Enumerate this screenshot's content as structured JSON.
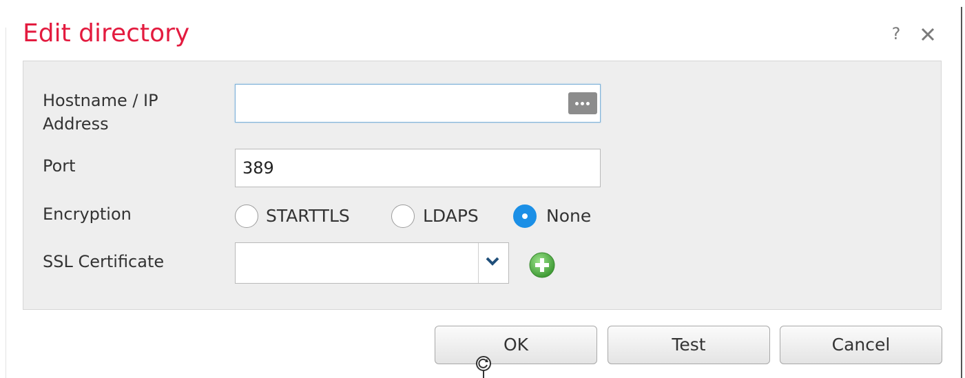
{
  "dialog": {
    "title": "Edit directory",
    "help_glyph": "?",
    "close_glyph": "✕"
  },
  "form": {
    "hostname": {
      "label": "Hostname / IP Address",
      "value": "",
      "button_icon": "ellipsis-icon"
    },
    "port": {
      "label": "Port",
      "value": "389"
    },
    "encryption": {
      "label": "Encryption",
      "options": [
        {
          "label": "STARTTLS",
          "checked": false
        },
        {
          "label": "LDAPS",
          "checked": false
        },
        {
          "label": "None",
          "checked": true
        }
      ]
    },
    "ssl_certificate": {
      "label": "SSL Certificate",
      "value": "",
      "add_icon": "add-circle-icon"
    }
  },
  "buttons": {
    "ok": "OK",
    "test": "Test",
    "cancel": "Cancel"
  },
  "colors": {
    "title": "#e31b3f",
    "radio_selected": "#1b8fe6",
    "add_button": "#5bb84a",
    "panel_background": "#eeeeee"
  }
}
